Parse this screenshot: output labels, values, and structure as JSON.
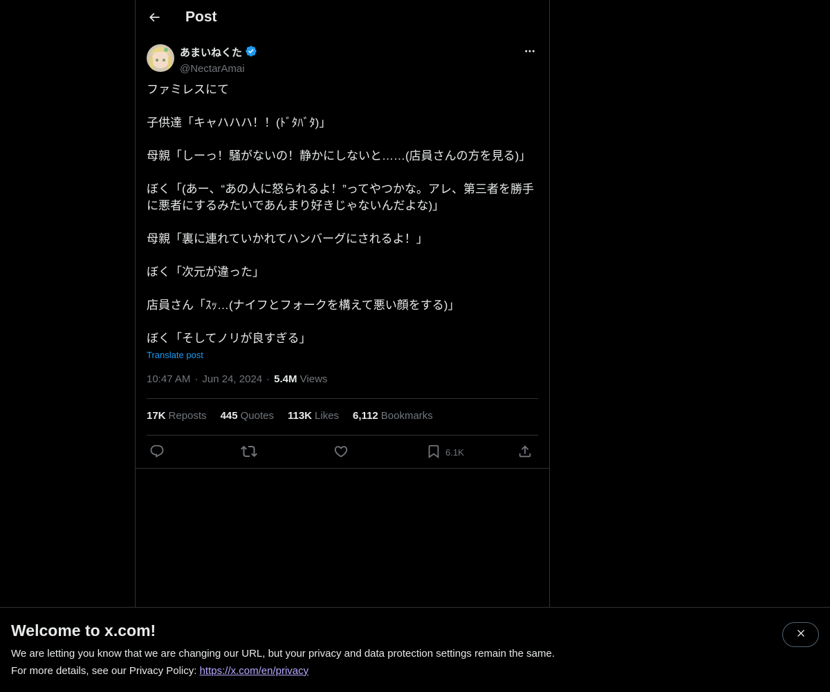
{
  "header": {
    "title": "Post",
    "back_icon": "arrow-left-icon"
  },
  "author": {
    "display_name": "あまいねくた",
    "handle": "@NectarAmai",
    "verified": true,
    "verified_color": "#1d9bf0"
  },
  "tweet": {
    "paragraphs": [
      "ファミレスにて",
      "子供達「キャハハハ！！(ﾄﾞﾀﾊﾞﾀ)」",
      "母親「しーっ！騒がないの！静かにしないと……(店員さんの方を見る)」",
      "ぼく「(あー、“あの人に怒られるよ！”ってやつかな。アレ、第三者を勝手\nに悪者にするみたいであんまり好きじゃないんだよな)」",
      "母親「裏に連れていかれてハンバーグにされるよ！」",
      "ぼく「次元が違った」",
      "店員さん「ｽｯ…(ナイフとフォークを構えて悪い顔をする)」",
      "ぼく「そしてノリが良すぎる」"
    ],
    "translate_label": "Translate post",
    "time": "10:47 AM",
    "separator": "·",
    "date": "Jun 24, 2024",
    "views_count": "5.4M",
    "views_label": "Views"
  },
  "stats": {
    "reposts_count": "17K",
    "reposts_label": "Reposts",
    "quotes_count": "445",
    "quotes_label": "Quotes",
    "likes_count": "113K",
    "likes_label": "Likes",
    "bookmarks_count": "6,112",
    "bookmarks_label": "Bookmarks"
  },
  "actions": {
    "bookmark_count": "6.1K"
  },
  "banner": {
    "title": "Welcome to x.com!",
    "text1": "We are letting you know that we are changing our URL, but your privacy and data protection settings remain the same.",
    "text2_prefix": "For more details, see our Privacy Policy: ",
    "privacy_link": "https://x.com/en/privacy"
  },
  "colors": {
    "background": "#000000",
    "text": "#e7e9ea",
    "muted": "#71767b",
    "link": "#1d9bf0",
    "border": "#2f3336"
  }
}
